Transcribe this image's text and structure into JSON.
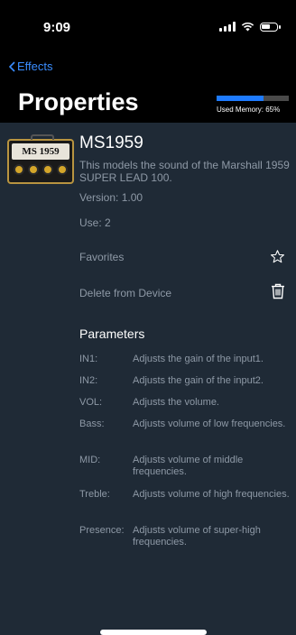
{
  "status": {
    "time": "9:09"
  },
  "nav": {
    "back_label": "Effects",
    "title": "Properties"
  },
  "memory": {
    "label": "Used Memory: 65%",
    "used_fraction": 0.65,
    "fill_color": "#1e7bff"
  },
  "effect": {
    "thumbnail_text": "MS 1959",
    "name": "MS1959",
    "description": "This models the sound of the Marshall 1959 SUPER LEAD 100.",
    "version": "Version: 1.00",
    "use": "Use: 2"
  },
  "actions": {
    "favorites_label": "Favorites",
    "favorites_icon": "star-outline-icon",
    "delete_label": "Delete from Device",
    "delete_icon": "trash-icon"
  },
  "parameters": {
    "title": "Parameters",
    "items": [
      {
        "name": "IN1:",
        "desc": "Adjusts the gain of the input1."
      },
      {
        "name": "IN2:",
        "desc": "Adjusts the gain of the input2."
      },
      {
        "name": "VOL:",
        "desc": "Adjusts the volume."
      },
      {
        "name": "Bass:",
        "desc": "Adjusts volume of low frequencies."
      },
      {
        "name": "MID:",
        "desc": "Adjusts volume of middle frequencies."
      },
      {
        "name": "Treble:",
        "desc": "Adjusts volume of high frequencies."
      },
      {
        "name": "Presence:",
        "desc": "Adjusts volume of super-high frequencies."
      }
    ]
  },
  "colors": {
    "accent": "#3a8dff",
    "background": "#1f2a36",
    "header": "#000000",
    "secondary_text": "#8e99a6"
  }
}
